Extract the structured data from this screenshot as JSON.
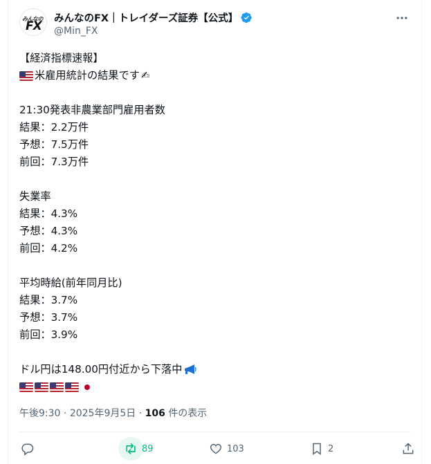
{
  "account": {
    "display_name": "みんなのFX｜トレイダーズ証券【公式】",
    "handle": "@Min_FX",
    "avatar_text_top": "みんなの",
    "avatar_text_main": "FX"
  },
  "post": {
    "lines": [
      "【経済指標速報】",
      "米雇用統計の結果です",
      "",
      "21:30発表非農業部門雇用者数",
      "結果：2.2万件",
      "予想：7.5万件",
      "前回：7.3万件",
      "",
      "失業率",
      "結果：4.3%",
      "予想：4.3%",
      "前回：4.2%",
      "",
      "平均時給(前年同月比)",
      "結果：3.7%",
      "予想：3.7%",
      "前回：3.9%",
      "",
      "ドル円は148.00円付近から下落中"
    ]
  },
  "meta": {
    "time": "午後9:30",
    "separator": "·",
    "date": "2025年9月5日",
    "views_count": "106",
    "views_label": "件の表示"
  },
  "actions": {
    "reply_count": "",
    "retweet_count": "89",
    "like_count": "103",
    "bookmark_count": "2"
  },
  "colors": {
    "text": "#0f1419",
    "secondary": "#536471",
    "verified": "#1d9bf0",
    "retweet": "#00ba7c"
  },
  "icons": [
    "more-icon",
    "verified-icon",
    "reply-icon",
    "retweet-icon",
    "like-icon",
    "bookmark-icon",
    "share-icon",
    "us-flag-icon",
    "japan-flag-icon",
    "writing-hand-icon",
    "megaphone-icon"
  ]
}
